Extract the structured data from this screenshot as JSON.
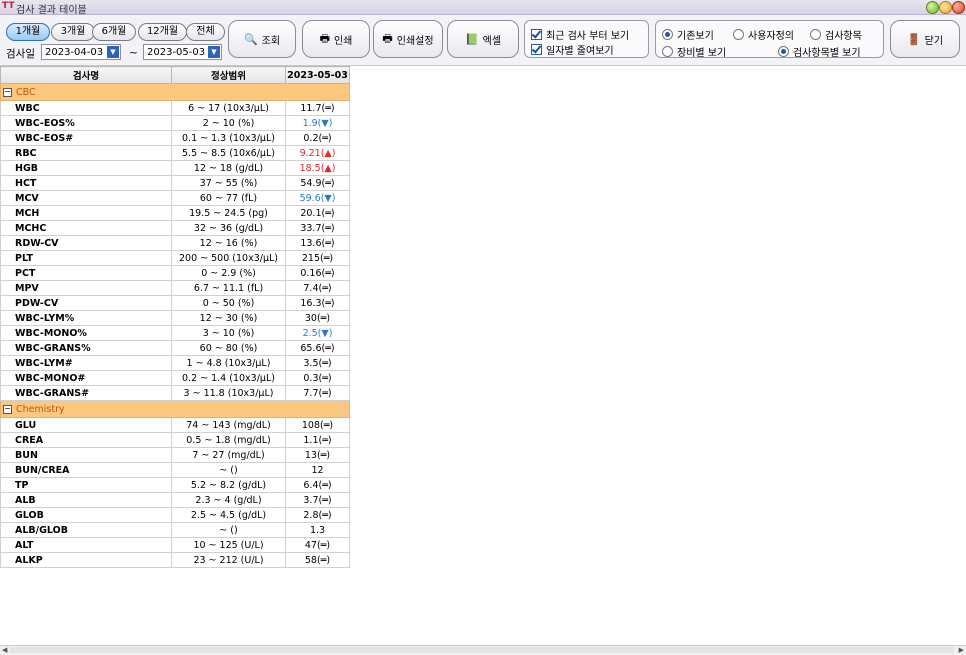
{
  "window": {
    "title": "검사 결과 테이블",
    "icon_text": "TT"
  },
  "toolbar": {
    "period_buttons": [
      "1개월",
      "3개월",
      "6개월",
      "12개월",
      "전체"
    ],
    "active_period": "1개월",
    "date_label": "검사일",
    "date_from": "2023-04-03",
    "date_sep": "~",
    "date_to": "2023-05-03",
    "search_label": "조회",
    "print_label": "인쇄",
    "print_settings_label": "인쇄설정",
    "excel_label": "엑셀",
    "checkbox_recent": "최근 검사 부터 보기",
    "checkbox_recent_checked": true,
    "checkbox_compact": "일자별 줄여보기",
    "checkbox_compact_checked": true,
    "view_basic": "기존보기",
    "view_custom": "사용자정의",
    "view_item": "검사항목",
    "view_device": "장비별 보기",
    "view_by_item": "검사항목별 보기",
    "close_label": "닫기"
  },
  "table": {
    "headers": [
      "검사명",
      "정상범위",
      "2023-05-03"
    ],
    "groups": [
      {
        "name": "CBC",
        "rows": [
          {
            "name": "WBC",
            "range": "6 ~ 17 (10x3/μL)",
            "value": "11.7(═)",
            "flag": "normal"
          },
          {
            "name": "WBC-EOS%",
            "range": "2 ~ 10 (%)",
            "value": "1.9(▼)",
            "flag": "low"
          },
          {
            "name": "WBC-EOS#",
            "range": "0.1 ~ 1.3 (10x3/μL)",
            "value": "0.2(═)",
            "flag": "normal"
          },
          {
            "name": "RBC",
            "range": "5.5 ~ 8.5 (10x6/μL)",
            "value": "9.21(▲)",
            "flag": "high"
          },
          {
            "name": "HGB",
            "range": "12 ~ 18 (g/dL)",
            "value": "18.5(▲)",
            "flag": "high"
          },
          {
            "name": "HCT",
            "range": "37 ~ 55 (%)",
            "value": "54.9(═)",
            "flag": "normal"
          },
          {
            "name": "MCV",
            "range": "60 ~ 77 (fL)",
            "value": "59.6(▼)",
            "flag": "low"
          },
          {
            "name": "MCH",
            "range": "19.5 ~ 24.5 (pg)",
            "value": "20.1(═)",
            "flag": "normal"
          },
          {
            "name": "MCHC",
            "range": "32 ~ 36 (g/dL)",
            "value": "33.7(═)",
            "flag": "normal"
          },
          {
            "name": "RDW-CV",
            "range": "12 ~ 16 (%)",
            "value": "13.6(═)",
            "flag": "normal"
          },
          {
            "name": "PLT",
            "range": "200 ~ 500 (10x3/μL)",
            "value": "215(═)",
            "flag": "normal"
          },
          {
            "name": "PCT",
            "range": "0 ~ 2.9 (%)",
            "value": "0.16(═)",
            "flag": "normal"
          },
          {
            "name": "MPV",
            "range": "6.7 ~ 11.1 (fL)",
            "value": "7.4(═)",
            "flag": "normal"
          },
          {
            "name": "PDW-CV",
            "range": "0 ~ 50 (%)",
            "value": "16.3(═)",
            "flag": "normal"
          },
          {
            "name": "WBC-LYM%",
            "range": "12 ~ 30 (%)",
            "value": "30(═)",
            "flag": "normal"
          },
          {
            "name": "WBC-MONO%",
            "range": "3 ~ 10 (%)",
            "value": "2.5(▼)",
            "flag": "low"
          },
          {
            "name": "WBC-GRANS%",
            "range": "60 ~ 80 (%)",
            "value": "65.6(═)",
            "flag": "normal"
          },
          {
            "name": "WBC-LYM#",
            "range": "1 ~ 4.8 (10x3/μL)",
            "value": "3.5(═)",
            "flag": "normal"
          },
          {
            "name": "WBC-MONO#",
            "range": "0.2 ~ 1.4 (10x3/μL)",
            "value": "0.3(═)",
            "flag": "normal"
          },
          {
            "name": "WBC-GRANS#",
            "range": "3 ~ 11.8 (10x3/μL)",
            "value": "7.7(═)",
            "flag": "normal"
          }
        ]
      },
      {
        "name": "Chemistry",
        "rows": [
          {
            "name": "GLU",
            "range": "74 ~ 143 (mg/dL)",
            "value": "108(═)",
            "flag": "normal"
          },
          {
            "name": "CREA",
            "range": "0.5 ~ 1.8 (mg/dL)",
            "value": "1.1(═)",
            "flag": "normal"
          },
          {
            "name": "BUN",
            "range": "7 ~ 27 (mg/dL)",
            "value": "13(═)",
            "flag": "normal"
          },
          {
            "name": "BUN/CREA",
            "range": "~ ()",
            "value": "12",
            "flag": "normal"
          },
          {
            "name": "TP",
            "range": "5.2 ~ 8.2 (g/dL)",
            "value": "6.4(═)",
            "flag": "normal"
          },
          {
            "name": "ALB",
            "range": "2.3 ~ 4 (g/dL)",
            "value": "3.7(═)",
            "flag": "normal"
          },
          {
            "name": "GLOB",
            "range": "2.5 ~ 4.5 (g/dL)",
            "value": "2.8(═)",
            "flag": "normal"
          },
          {
            "name": "ALB/GLOB",
            "range": "~ ()",
            "value": "1.3",
            "flag": "normal"
          },
          {
            "name": "ALT",
            "range": "10 ~ 125 (U/L)",
            "value": "47(═)",
            "flag": "normal"
          },
          {
            "name": "ALKP",
            "range": "23 ~ 212 (U/L)",
            "value": "58(═)",
            "flag": "normal"
          }
        ]
      }
    ]
  },
  "colors": {
    "group_bg": "#fcc77f",
    "group_text": "#c0570e",
    "high": "#e5262c",
    "low": "#2a79d1"
  }
}
